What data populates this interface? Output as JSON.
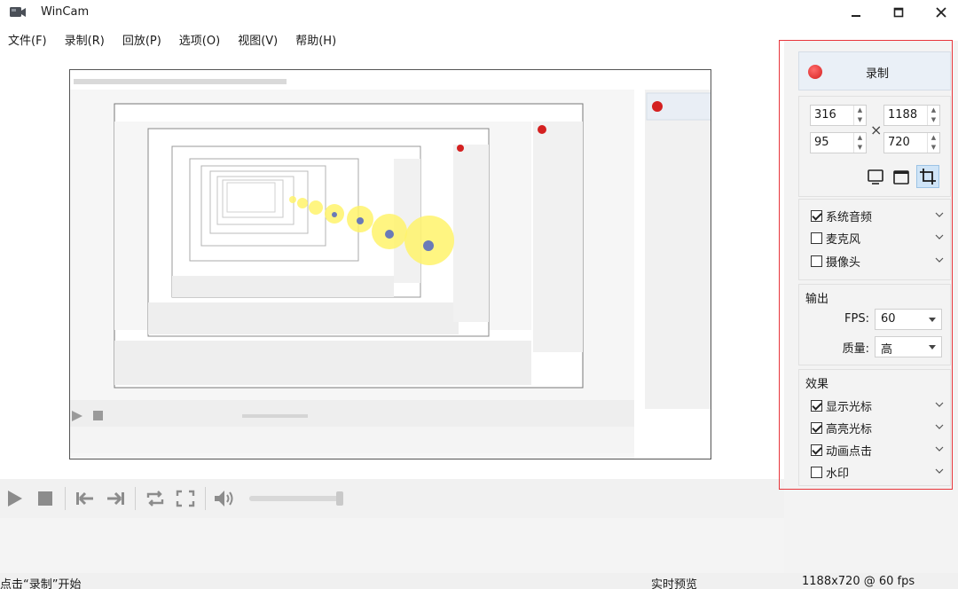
{
  "window": {
    "title": "WinCam"
  },
  "menu": [
    "文件(F)",
    "录制(R)",
    "回放(P)",
    "选项(O)",
    "视图(V)",
    "帮助(H)"
  ],
  "panel": {
    "record_label": "录制",
    "region": {
      "x": "316",
      "y": "95",
      "width": "1188",
      "height": "720"
    },
    "audio": [
      {
        "label": "系统音频",
        "checked": true
      },
      {
        "label": "麦克风",
        "checked": false
      },
      {
        "label": "摄像头",
        "checked": false
      }
    ],
    "output": {
      "title": "输出",
      "fps_label": "FPS:",
      "fps_value": "60",
      "quality_label": "质量:",
      "quality_value": "高"
    },
    "effects": {
      "title": "效果",
      "items": [
        {
          "label": "显示光标",
          "checked": true
        },
        {
          "label": "高亮光标",
          "checked": true
        },
        {
          "label": "动画点击",
          "checked": true
        },
        {
          "label": "水印",
          "checked": false
        }
      ]
    }
  },
  "status": {
    "left": "点击“录制”开始",
    "mid": "实时预览",
    "right": "1188x720 @ 60 fps"
  },
  "volume_level": 0.98,
  "colors": {
    "highlight": "#e8353b",
    "record": "#d42020",
    "active_mode": "#cfe4f7"
  }
}
